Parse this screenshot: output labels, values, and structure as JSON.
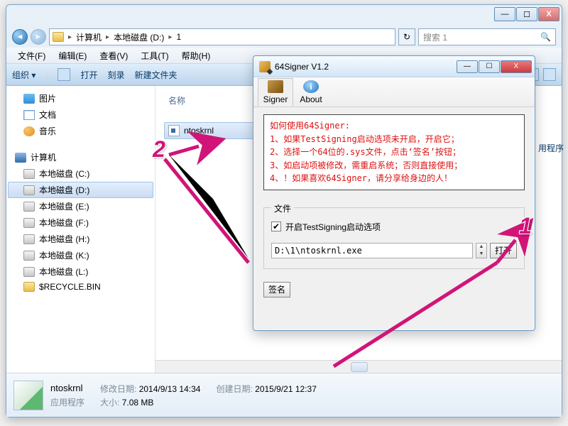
{
  "explorer": {
    "titlebar": {
      "min": "—",
      "max": "☐",
      "close": "X"
    },
    "address": {
      "segments": [
        "计算机",
        "本地磁盘 (D:)",
        "1"
      ],
      "refresh": "↻"
    },
    "search": {
      "placeholder": "搜索 1"
    },
    "menubar": [
      "文件(F)",
      "编辑(E)",
      "查看(V)",
      "工具(T)",
      "帮助(H)"
    ],
    "toolbar": {
      "organize": "组织 ▾",
      "open": "打开",
      "burn": "刻录",
      "newfolder": "新建文件夹"
    },
    "sidebar": {
      "pictures": "图片",
      "documents": "文档",
      "music": "音乐",
      "computer": "计算机",
      "drives": [
        "本地磁盘 (C:)",
        "本地磁盘 (D:)",
        "本地磁盘 (E:)",
        "本地磁盘 (F:)",
        "本地磁盘 (H:)",
        "本地磁盘 (K:)",
        "本地磁盘 (L:)"
      ],
      "recycle": "$RECYCLE.BIN"
    },
    "list": {
      "header_name": "名称",
      "file": "ntoskrnl"
    },
    "details": {
      "name": "ntoskrnl",
      "type": "应用程序",
      "mod_label": "修改日期:",
      "mod_value": "2014/9/13 14:34",
      "size_label": "大小:",
      "size_value": "7.08 MB",
      "create_label": "创建日期:",
      "create_value": "2015/9/21 12:37",
      "extra_hint": "用程序"
    }
  },
  "dialog": {
    "title": "64Signer V1.2",
    "wbtn": {
      "min": "—",
      "max": "☐",
      "close": "X"
    },
    "tabs": {
      "signer": "Signer",
      "about": "About",
      "info_i": "i"
    },
    "info": {
      "l0": "如何使用64Signer:",
      "l1": "1、如果TestSigning启动选项未开启，开启它；",
      "l2": "2、选择一个64位的.sys文件，点击‘签名’按钮；",
      "l3": "3、如启动项被修改，需重启系统；否则直接使用；",
      "l4": "4、！如果喜欢64Signer，请分享给身边的人！"
    },
    "filegroup": {
      "legend": "文件",
      "chk_label": "开启TestSigning启动选项",
      "chk_mark": "✔",
      "path": "D:\\1\\ntoskrnl.exe",
      "open": "打开",
      "sign": "签名"
    }
  },
  "annotations": {
    "one": "1",
    "two": "2"
  }
}
